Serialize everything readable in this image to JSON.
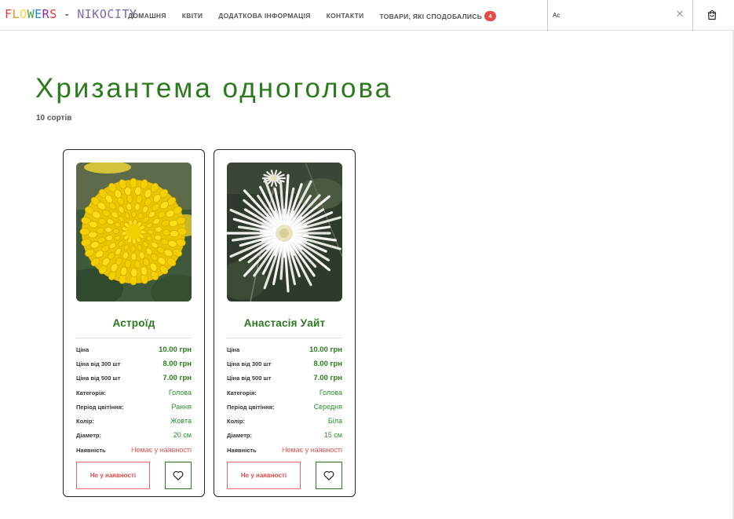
{
  "header": {
    "logo": {
      "left": "FLOWERS",
      "separator": "-",
      "right": "NIKOCITY"
    },
    "nav": [
      {
        "label": "ДОМАШНЯ"
      },
      {
        "label": "КВІТИ"
      },
      {
        "label": "ДОДАТКОВА ІНФОРМАЦІЯ"
      },
      {
        "label": "КОНТАКТИ"
      }
    ],
    "favorites": {
      "label": "ТОВАРИ, ЯКІ СПОДОБАЛИСЬ",
      "count": "4"
    },
    "search": {
      "value": "Ac"
    },
    "icons": {
      "clear": "close-icon",
      "cart": "shopping-bag-icon"
    }
  },
  "page": {
    "title": "Хризантема одноголова",
    "count": "10 сортів"
  },
  "products": [
    {
      "name": "Астроїд",
      "image": "yellow-chrysanthemum",
      "specs": [
        {
          "key": "Ціна",
          "value": "10.00 грн"
        },
        {
          "key": "Ціна від 300 шт",
          "value": "8.00 грн"
        },
        {
          "key": "Ціна від 500 шт",
          "value": "7.00 грн"
        },
        {
          "key": "Категорія:",
          "value": "Голова"
        },
        {
          "key": "Період цвітіння:",
          "value": "Рання"
        },
        {
          "key": "Колір:",
          "value": "Жовта"
        },
        {
          "key": "Діаметр:",
          "value": "20 см"
        },
        {
          "key": "Наявність",
          "value": "Немає у наявності"
        }
      ],
      "stock_button": "Не у наявності"
    },
    {
      "name": "Анастасія Уайт",
      "image": "white-spider-chrysanthemum",
      "specs": [
        {
          "key": "Ціна",
          "value": "10.00 грн"
        },
        {
          "key": "Ціна від 300 шт",
          "value": "8.00 грн"
        },
        {
          "key": "Ціна від 500 шт",
          "value": "7.00 грн"
        },
        {
          "key": "Категорія:",
          "value": "Голова"
        },
        {
          "key": "Період цвітіння:",
          "value": "Середня"
        },
        {
          "key": "Колір:",
          "value": "Біла"
        },
        {
          "key": "Діаметр:",
          "value": "15 см"
        },
        {
          "key": "Наявність",
          "value": "Немає у наявності"
        }
      ],
      "stock_button": "Не у наявності"
    }
  ],
  "colors": {
    "brand_green": "#2b7a1e",
    "alert_red": "#e05050",
    "badge_red": "#e74c4c"
  }
}
